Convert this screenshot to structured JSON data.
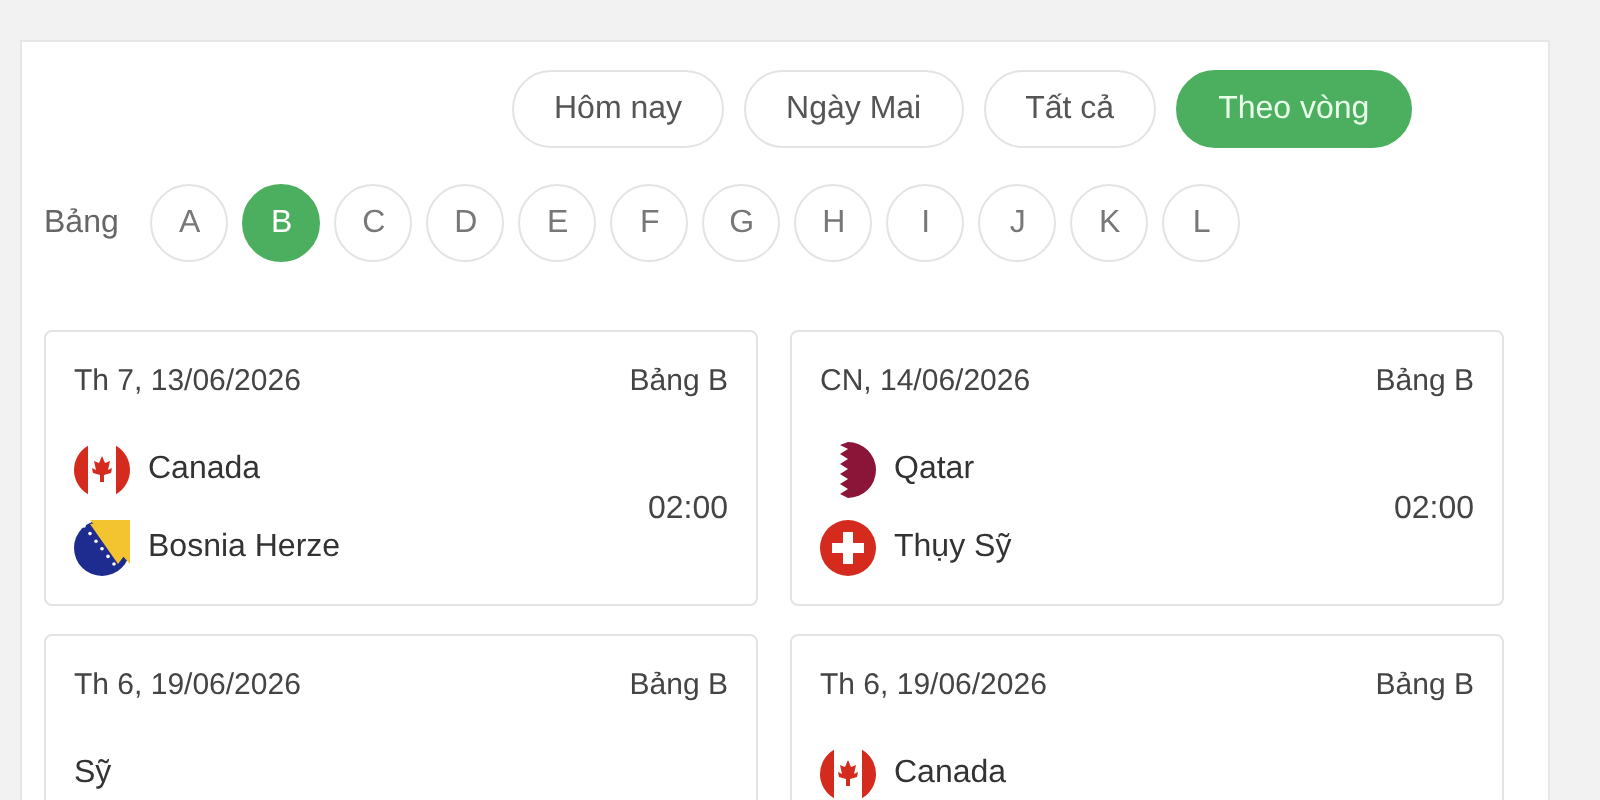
{
  "tabs": [
    {
      "label": "Hôm nay",
      "selected": false
    },
    {
      "label": "Ngày Mai",
      "selected": false
    },
    {
      "label": "Tất cả",
      "selected": false
    },
    {
      "label": "Theo vòng",
      "selected": true
    }
  ],
  "groups": {
    "label": "Bảng",
    "items": [
      {
        "label": "A",
        "selected": false
      },
      {
        "label": "B",
        "selected": true
      },
      {
        "label": "C",
        "selected": false
      },
      {
        "label": "D",
        "selected": false
      },
      {
        "label": "E",
        "selected": false
      },
      {
        "label": "F",
        "selected": false
      },
      {
        "label": "G",
        "selected": false
      },
      {
        "label": "H",
        "selected": false
      },
      {
        "label": "I",
        "selected": false
      },
      {
        "label": "J",
        "selected": false
      },
      {
        "label": "K",
        "selected": false
      },
      {
        "label": "L",
        "selected": false
      }
    ]
  },
  "matches": [
    {
      "date": "Th 7, 13/06/2026",
      "group": "Bảng B",
      "time": "02:00",
      "teams": [
        {
          "name": "Canada",
          "kind": "canada"
        },
        {
          "name": "Bosnia Herze",
          "kind": "bosnia"
        }
      ]
    },
    {
      "date": "CN, 14/06/2026",
      "group": "Bảng B",
      "time": "02:00",
      "teams": [
        {
          "name": "Qatar",
          "kind": "qatar"
        },
        {
          "name": "Thụy Sỹ",
          "kind": "swiss"
        }
      ]
    },
    {
      "date": "Th 6, 19/06/2026",
      "group": "Bảng B",
      "teams": [
        {
          "name": "Sỹ",
          "kind": "hidden"
        }
      ]
    },
    {
      "date": "Th 6, 19/06/2026",
      "group": "Bảng B",
      "teams": [
        {
          "name": "Canada",
          "kind": "canada"
        }
      ]
    }
  ]
}
